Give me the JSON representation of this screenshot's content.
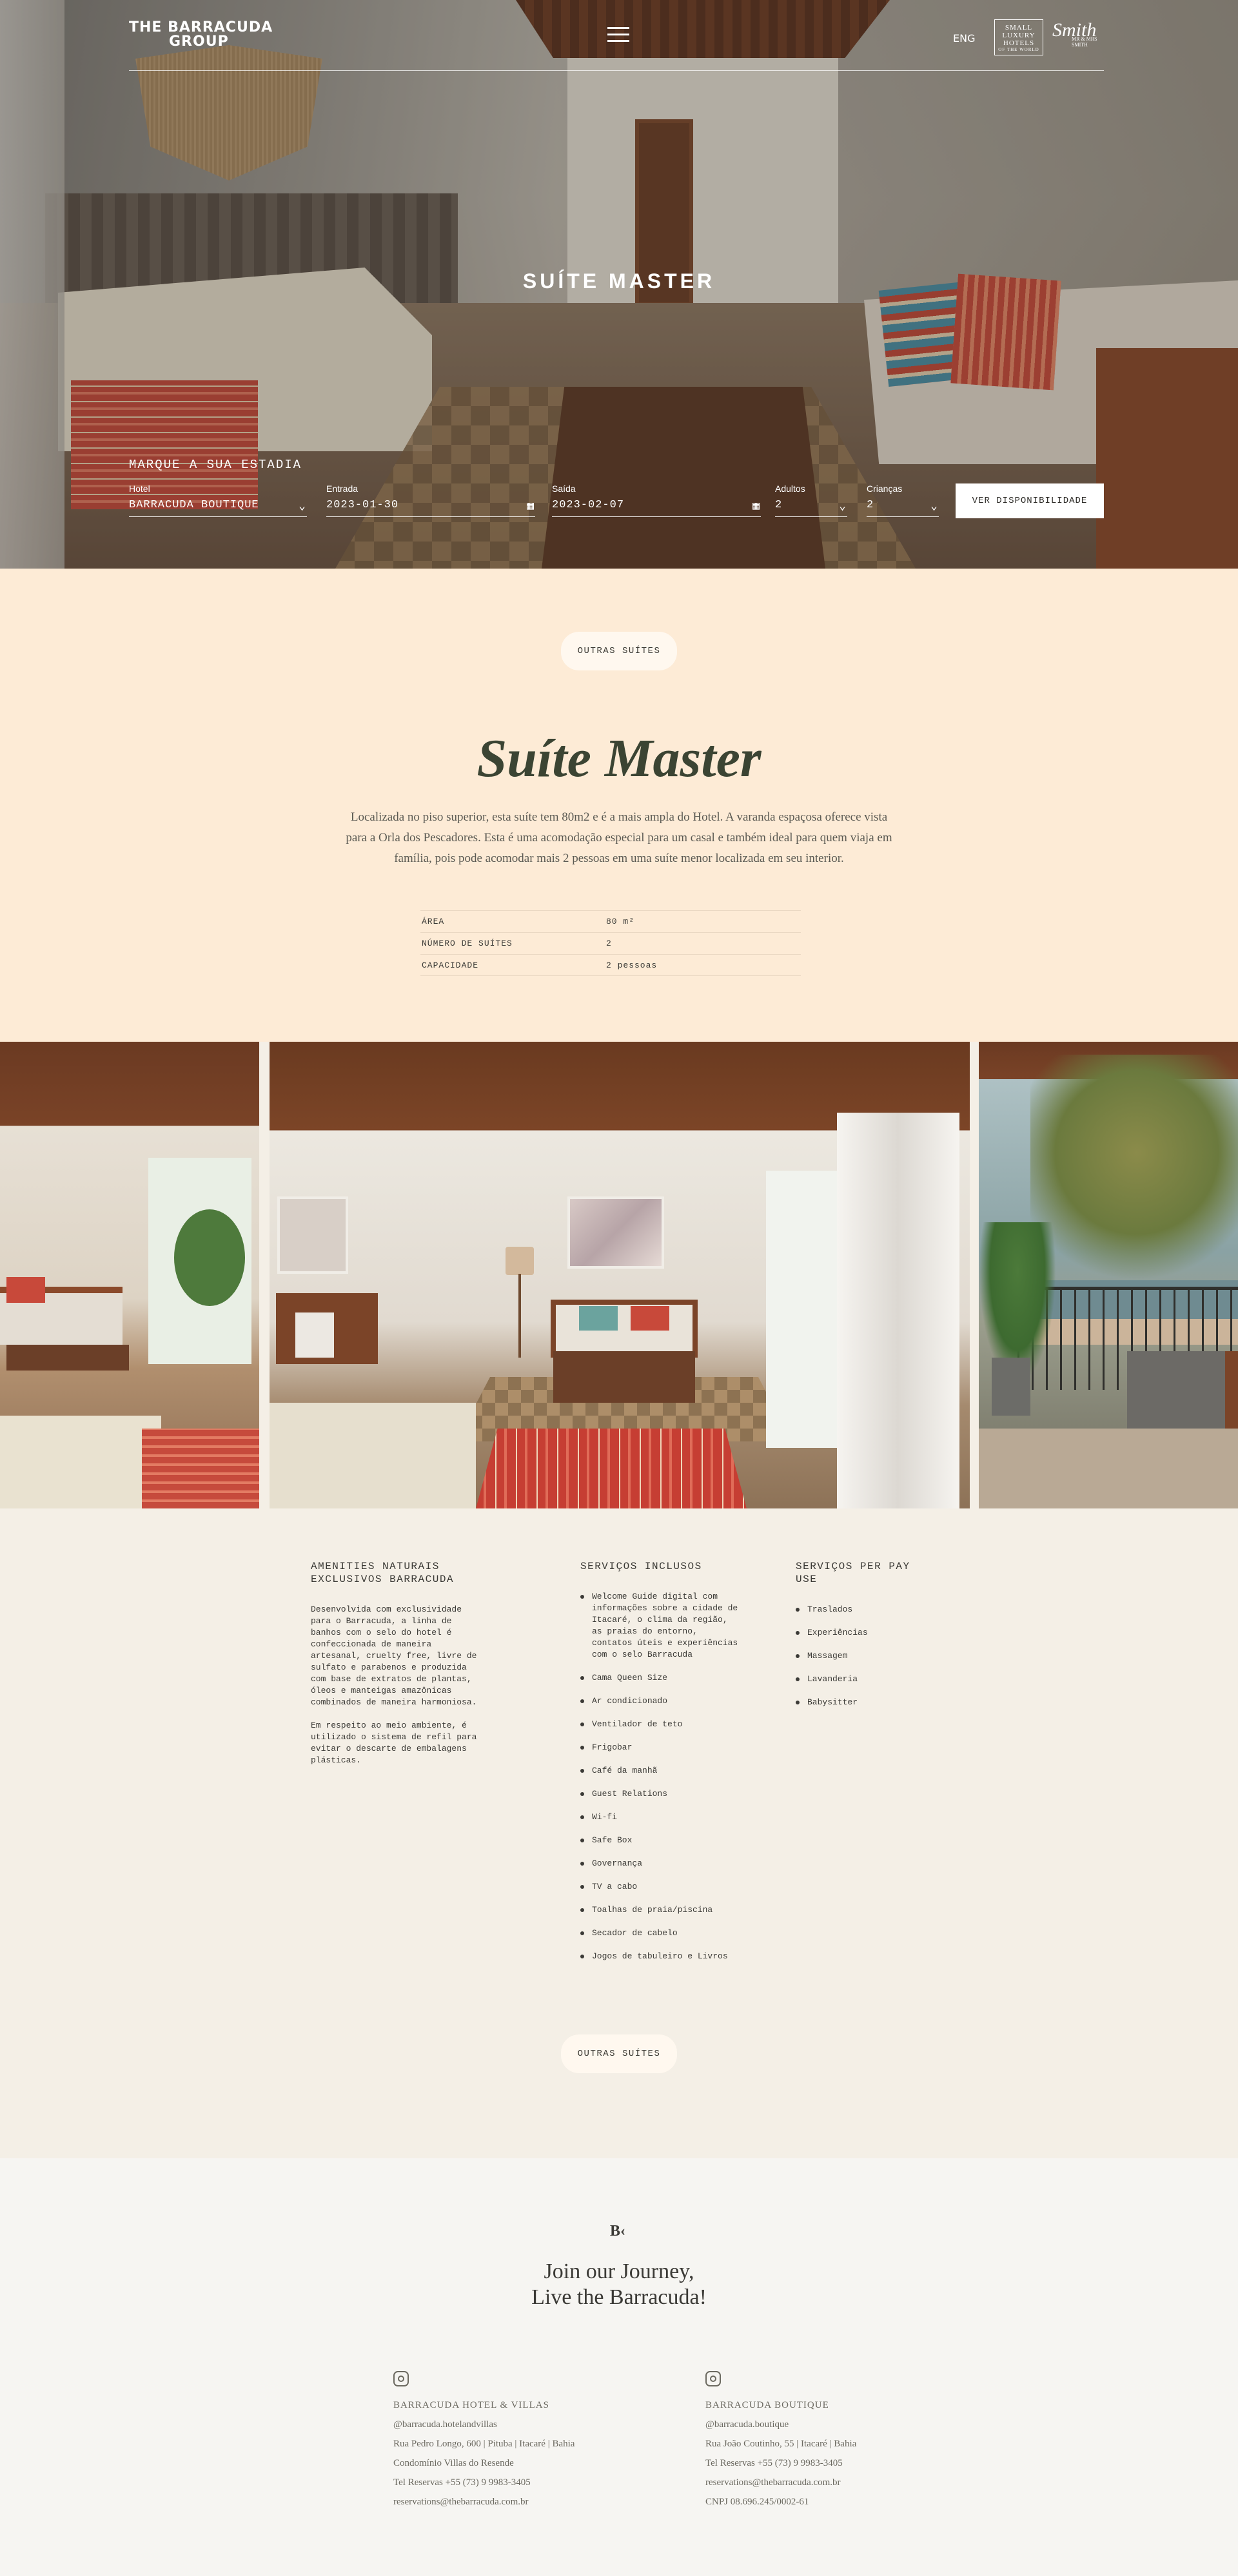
{
  "header": {
    "logo_line1": "THE BARRACUDA",
    "logo_line2": "GROUP",
    "language": "ENG",
    "partner_badge": "SMALL LUXURY HOTELS OF THE WORLD",
    "partner_badge_lines": [
      "SMALL",
      "LUXURY",
      "HOTELS",
      "OF THE WORLD"
    ],
    "partner_smith": "Smith",
    "partner_smith_sub": "MR & MRS SMITH"
  },
  "hero": {
    "title": "SUÍTE MASTER"
  },
  "booking": {
    "title": "MARQUE A SUA ESTADIA",
    "hotel": {
      "label": "Hotel",
      "value": "BARRACUDA BOUTIQUE"
    },
    "checkin": {
      "label": "Entrada",
      "value": "2023-01-30"
    },
    "checkout": {
      "label": "Saída",
      "value": "2023-02-07"
    },
    "adults": {
      "label": "Adultos",
      "value": "2"
    },
    "children": {
      "label": "Crianças",
      "value": "2"
    },
    "submit_label": "VER DISPONIBILIDADE"
  },
  "info": {
    "other_suites_label": "OUTRAS SUÍTES",
    "title": "Suíte Master",
    "description": "Localizada no piso superior, esta suíte tem 80m2 e é a mais ampla do Hotel. A varanda espaçosa oferece vista para a Orla dos Pescadores. Esta é uma acomodação especial para um casal e também ideal para quem viaja em família, pois pode acomodar mais 2 pessoas em uma suíte menor localizada em seu interior.",
    "specs": [
      {
        "key": "ÁREA",
        "value": "80 m²"
      },
      {
        "key": "NÚMERO DE SUÍTES",
        "value": "2"
      },
      {
        "key": "CAPACIDADE",
        "value": "2 pessoas"
      }
    ]
  },
  "amenities": {
    "col1": {
      "title": "AMENITIES NATURAIS EXCLUSIVOS BARRACUDA",
      "paragraphs": [
        "Desenvolvida com exclusividade para o Barracuda, a linha de banhos com o selo do hotel é confeccionada de maneira artesanal, cruelty free, livre de sulfato e parabenos e produzida com base de extratos de plantas, óleos e manteigas amazônicas combinados de maneira harmoniosa.",
        "Em respeito ao meio ambiente, é utilizado o sistema de refil para evitar o descarte de embalagens plásticas."
      ]
    },
    "col2": {
      "title": "SERVIÇOS INCLUSOS",
      "items": [
        "Welcome Guide digital com informações sobre a cidade de Itacaré, o clima da região, as praias do entorno, contatos úteis e experiências com o selo Barracuda",
        "Cama Queen Size",
        "Ar condicionado",
        "Ventilador de teto",
        "Frigobar",
        "Café da manhã",
        "Guest Relations",
        "Wi-fi",
        "Safe Box",
        "Governança",
        "TV a cabo",
        "Toalhas de praia/piscina",
        "Secador de cabelo",
        "Jogos de tabuleiro e Livros"
      ]
    },
    "col3": {
      "title": "SERVIÇOS PER PAY USE",
      "items": [
        "Traslados",
        "Experiências",
        "Massagem",
        "Lavanderia",
        "Babysitter"
      ]
    },
    "other_suites_label": "OUTRAS SUÍTES"
  },
  "footer": {
    "mark": "B‹",
    "title_line1": "Join our Journey,",
    "title_line2": "Live the Barracuda!",
    "hotel1": {
      "name": "BARRACUDA HOTEL & VILLAS",
      "instagram": "@barracuda.hotelandvillas",
      "address": "Rua Pedro Longo, 600 | Pituba | Itacaré | Bahia",
      "address2": "Condomínio Villas do Resende",
      "phone": "Tel Reservas +55 (73) 9 9983-3405",
      "email": "reservations@thebarracuda.com.br"
    },
    "hotel2": {
      "name": "BARRACUDA BOUTIQUE",
      "instagram": "@barracuda.boutique",
      "address": "Rua João Coutinho, 55 | Itacaré | Bahia",
      "phone": "Tel Reservas +55 (73) 9 9983-3405",
      "email": "reservations@thebarracuda.com.br",
      "cnpj": "CNPJ 08.696.245/0002-61"
    }
  },
  "icons": {
    "menu": "hamburger-icon",
    "select": "chevron-down-icon",
    "calendar": "calendar-icon",
    "instagram": "instagram-icon"
  }
}
